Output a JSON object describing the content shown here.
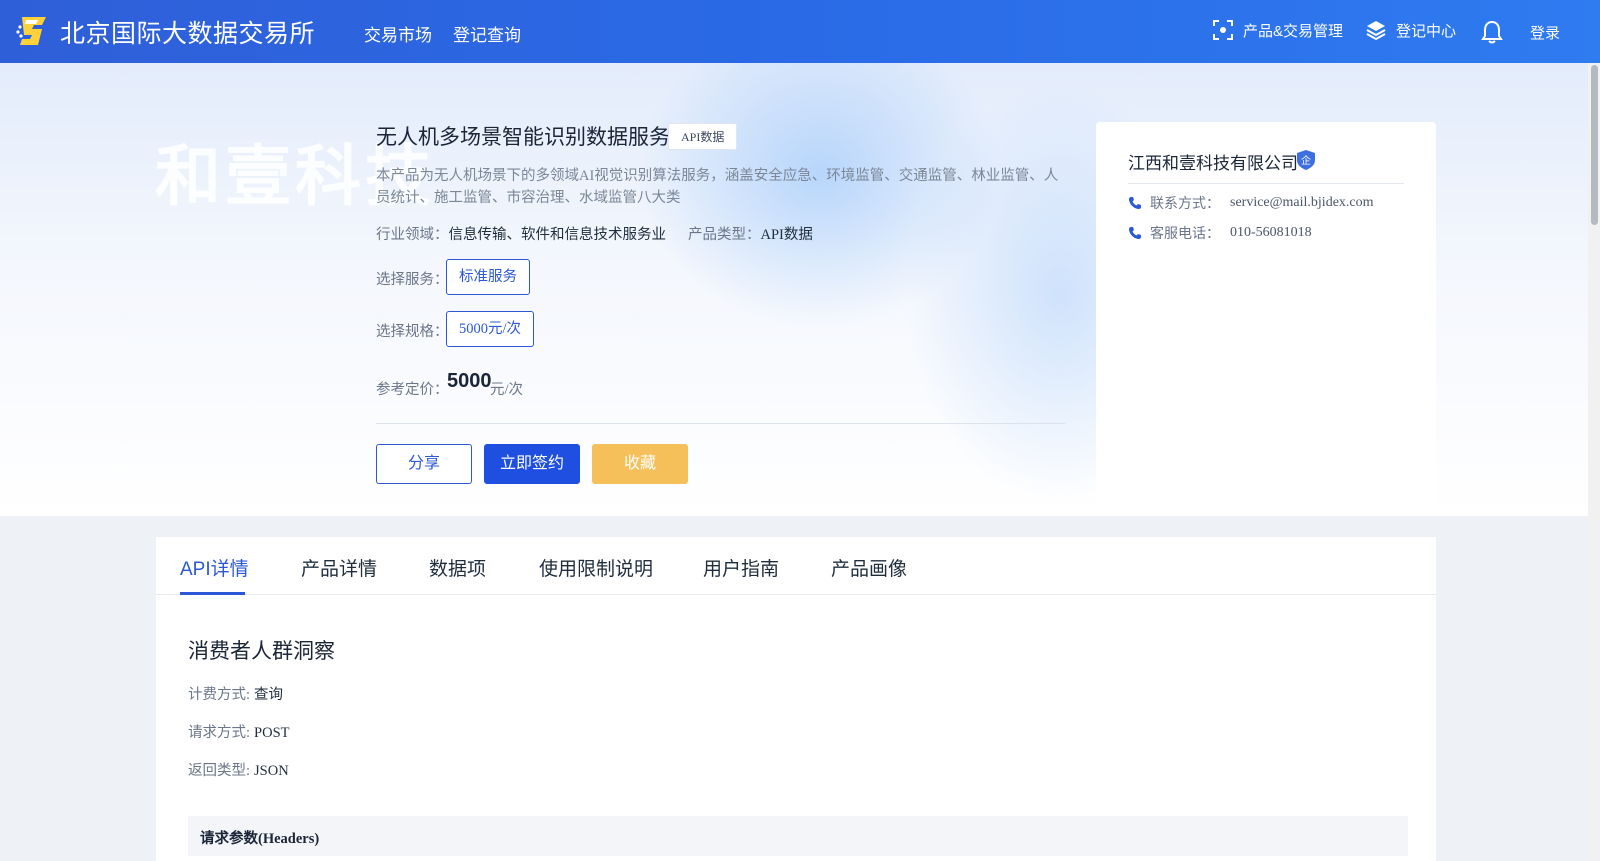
{
  "header": {
    "brand": "北京国际大数据交易所",
    "nav": [
      "交易市场",
      "登记查询"
    ],
    "product_mgmt": "产品&交易管理",
    "register_center": "登记中心",
    "login": "登录"
  },
  "product": {
    "watermark": "和壹科技",
    "title": "无人机多场景智能识别数据服务",
    "type_badge": "API数据",
    "description": "本产品为无人机场景下的多领域AI视觉识别算法服务，涵盖安全应急、环境监管、交通监管、林业监管、人员统计、施工监管、市容治理、水域监管八大类",
    "industry_label": "行业领域：",
    "industry_value": "信息传输、软件和信息技术服务业",
    "ptype_label": "产品类型：",
    "ptype_value": "API数据",
    "service_label": "选择服务：",
    "service_value": "标准服务",
    "spec_label": "选择规格：",
    "spec_value": "5000元/次",
    "price_label": "参考定价：",
    "price_value": "5000",
    "price_unit": "元/次",
    "share": "分享",
    "sign": "立即签约",
    "favorite": "收藏"
  },
  "company": {
    "name": "江西和壹科技有限公司",
    "badge": "企",
    "contact_label": "联系方式：",
    "contact_value": "service@mail.bjidex.com",
    "phone_label": "客服电话：",
    "phone_value": "010-56081018"
  },
  "tabs": [
    "API详情",
    "产品详情",
    "数据项",
    "使用限制说明",
    "用户指南",
    "产品画像"
  ],
  "api": {
    "section_title": "消费者人群洞察",
    "billing_label": "计费方式:",
    "billing_value": "查询",
    "method_label": "请求方式:",
    "method_value": "POST",
    "return_label": "返回类型:",
    "return_value": "JSON",
    "params_title": "请求参数(Headers)"
  },
  "colors": {
    "header_gradient_start": "#2f5fd8",
    "header_gradient_end": "#2f7bf0",
    "accent": "#2b58d6",
    "sign_button": "#1f4fe0",
    "favorite_button": "#f5c05a"
  }
}
